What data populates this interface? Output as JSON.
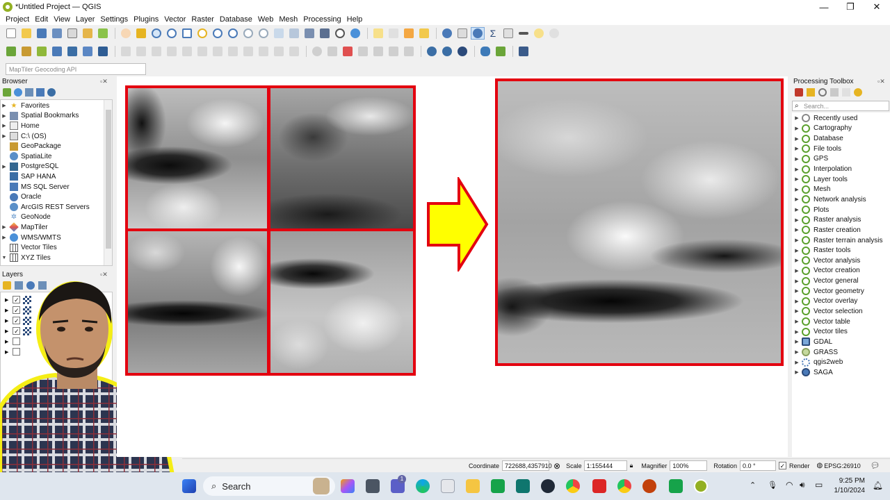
{
  "window": {
    "title": "*Untitled Project — QGIS",
    "controls": [
      "—",
      "❐",
      "✕"
    ]
  },
  "menu": [
    "Project",
    "Edit",
    "View",
    "Layer",
    "Settings",
    "Plugins",
    "Vector",
    "Raster",
    "Database",
    "Web",
    "Mesh",
    "Processing",
    "Help"
  ],
  "locator": {
    "placeholder": "MapTiler Geocoding API"
  },
  "browser": {
    "title": "Browser",
    "items": [
      {
        "label": "Favorites",
        "icon": "star-icon"
      },
      {
        "label": "Spatial Bookmarks",
        "icon": "bookmark-icon"
      },
      {
        "label": "Home",
        "icon": "home-icon"
      },
      {
        "label": "C:\\ (OS)",
        "icon": "drive-icon"
      },
      {
        "label": "GeoPackage",
        "icon": "geopackage-icon"
      },
      {
        "label": "SpatiaLite",
        "icon": "spatialite-icon"
      },
      {
        "label": "PostgreSQL",
        "icon": "postgresql-icon"
      },
      {
        "label": "SAP HANA",
        "icon": "sap-hana-icon"
      },
      {
        "label": "MS SQL Server",
        "icon": "mssql-icon"
      },
      {
        "label": "Oracle",
        "icon": "oracle-icon"
      },
      {
        "label": "ArcGIS REST Servers",
        "icon": "arcgis-icon"
      },
      {
        "label": "GeoNode",
        "icon": "geonode-icon"
      },
      {
        "label": "MapTiler",
        "icon": "maptiler-icon"
      },
      {
        "label": "WMS/WMTS",
        "icon": "wms-icon"
      },
      {
        "label": "Vector Tiles",
        "icon": "vector-tiles-icon"
      },
      {
        "label": "XYZ Tiles",
        "icon": "xyz-tiles-icon"
      }
    ]
  },
  "layers": {
    "title": "Layers",
    "rows": [
      true,
      true,
      true,
      true,
      false,
      false
    ]
  },
  "processing": {
    "title": "Processing Toolbox",
    "search_placeholder": "Search...",
    "items": [
      "Recently used",
      "Cartography",
      "Database",
      "File tools",
      "GPS",
      "Interpolation",
      "Layer tools",
      "Mesh",
      "Network analysis",
      "Plots",
      "Raster analysis",
      "Raster creation",
      "Raster terrain analysis",
      "Raster tools",
      "Vector analysis",
      "Vector creation",
      "Vector general",
      "Vector geometry",
      "Vector overlay",
      "Vector selection",
      "Vector table",
      "Vector tiles",
      "GDAL",
      "GRASS",
      "qgis2web",
      "SAGA"
    ]
  },
  "status": {
    "coordinate_label": "Coordinate",
    "coordinate_value": "722688,4357910",
    "scale_label": "Scale",
    "scale_value": "1:155444",
    "magnifier_label": "Magnifier",
    "magnifier_value": "100%",
    "rotation_label": "Rotation",
    "rotation_value": "0.0 °",
    "render_label": "Render",
    "crs": "EPSG:26910"
  },
  "taskbar": {
    "search": "Search",
    "time": "9:25 PM",
    "date": "1/10/2024",
    "badge": "1"
  },
  "colors": {
    "frame_red": "#e3000f",
    "arrow_yellow": "#ffff00",
    "qgis_green": "#93b023"
  }
}
